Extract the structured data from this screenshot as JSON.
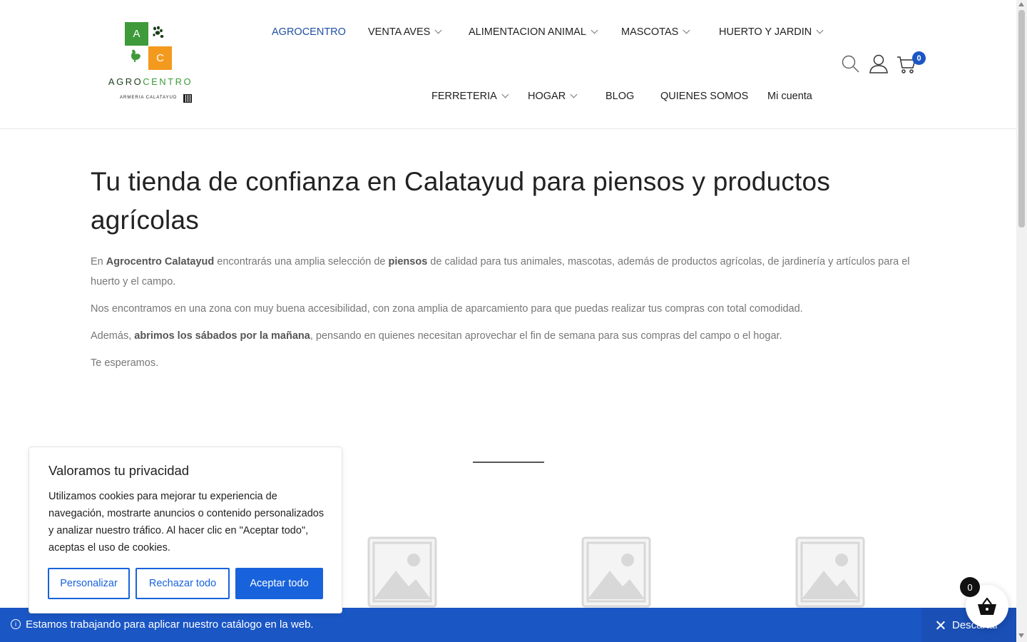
{
  "header": {
    "logo": {
      "letter_a": "A",
      "letter_c": "C",
      "brand_left": "AGRO",
      "brand_right": "CENTRO",
      "subtitle": "ARMERIA CALATAYUD"
    },
    "nav_row1": [
      {
        "label": "AGROCENTRO",
        "dropdown": false,
        "active": true
      },
      {
        "label": "VENTA AVES",
        "dropdown": true
      },
      {
        "label": "ALIMENTACION ANIMAL",
        "dropdown": true
      },
      {
        "label": "MASCOTAS",
        "dropdown": true
      },
      {
        "label": "HUERTO Y JARDIN",
        "dropdown": true
      }
    ],
    "nav_row2": [
      {
        "label": "FERRETERIA",
        "dropdown": true
      },
      {
        "label": "HOGAR",
        "dropdown": true
      },
      {
        "label": "BLOG",
        "dropdown": false
      },
      {
        "label": "QUIENES SOMOS",
        "dropdown": false
      },
      {
        "label": "Mi cuenta",
        "dropdown": false
      }
    ],
    "icons": {
      "search": "search-icon",
      "account": "user-icon",
      "cart": "cart-icon"
    },
    "cart_count": "0"
  },
  "main": {
    "title": "Tu tienda de confianza en Calatayud para piensos y productos agrícolas",
    "p1": {
      "t1": "En ",
      "b1": "Agrocentro Calatayud",
      "t2": " encontrarás una amplia selección de ",
      "b2": "piensos",
      "t3": " de calidad para tus animales, mascotas, además de productos agrícolas, de jardinería y artículos para el huerto y el campo."
    },
    "p2": "Nos encontramos en una zona con muy buena accesibilidad, con zona amplia  de aparcamiento para que puedas realizar tus compras con total comodidad.",
    "p3": {
      "t1": " Además, ",
      "b1": "abrimos los sábados por la mañana",
      "t2": ", pensando en quienes necesitan aprovechar el fin de semana para sus compras del campo o el hogar."
    },
    "p4": "Te esperamos."
  },
  "cookie": {
    "title": "Valoramos tu privacidad",
    "text": "Utilizamos cookies para mejorar tu experiencia de navegación, mostrarte anuncios o contenido personalizados y analizar nuestro tráfico. Al hacer clic en \"Aceptar todo\", aceptas el uso de cookies.",
    "customize": "Personalizar",
    "reject": "Rechazar todo",
    "accept": "Aceptar todo"
  },
  "notice": {
    "message": "Estamos trabajando para aplicar nuestro catálogo en la web.",
    "dismiss": "Descartar"
  },
  "basket": {
    "count": "0"
  },
  "colors": {
    "primary": "#1a56c4",
    "cookie_blue": "#1863dc",
    "logo_green": "#3e9a3a",
    "logo_orange": "#f39a1e"
  }
}
